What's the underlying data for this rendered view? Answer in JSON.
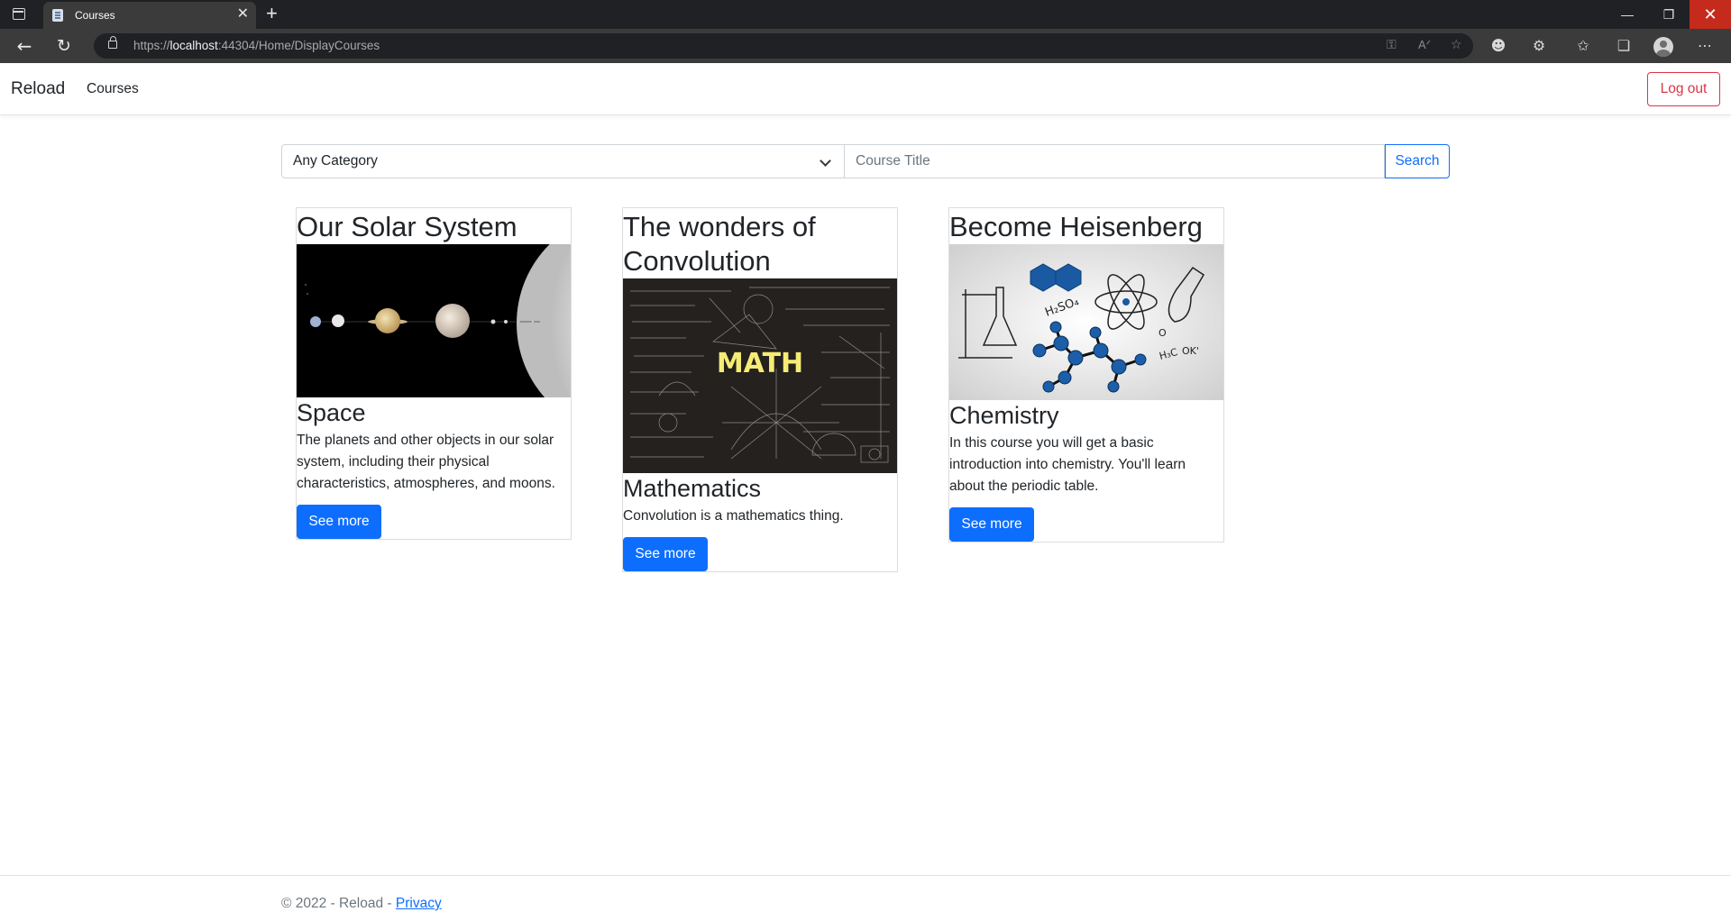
{
  "browser": {
    "tab_title": "Courses",
    "url_prefix": "https://",
    "url_host": "localhost",
    "url_rest": ":44304/Home/DisplayCourses"
  },
  "navbar": {
    "brand": "Reload",
    "courses_link": "Courses",
    "logout_label": "Log out"
  },
  "search": {
    "category_selected": "Any Category",
    "title_placeholder": "Course Title",
    "button_label": "Search"
  },
  "courses": [
    {
      "title": "Our Solar System",
      "category": "Space",
      "description": "The planets and other objects in our solar system, including their physical characteristics, atmospheres, and moons.",
      "button": "See more",
      "image_icon": "solar-system-image"
    },
    {
      "title": "The wonders of Convolution",
      "category": "Mathematics",
      "description": "Convolution is a mathematics thing.",
      "button": "See more",
      "image_icon": "math-chalkboard-image",
      "image_text": "MATH"
    },
    {
      "title": "Become Heisenberg",
      "category": "Chemistry",
      "description": "In this course you will get a basic introduction into chemistry. You'll learn about the periodic table.",
      "button": "See more",
      "image_icon": "chemistry-image",
      "image_text_1": "H₂SO₄",
      "image_text_2": "H₃C",
      "image_text_3": "O",
      "image_text_4": "OK'"
    }
  ],
  "footer": {
    "copyright": "© 2022 - Reload - ",
    "privacy_link": "Privacy"
  },
  "colors": {
    "primary": "#0d6efd",
    "danger": "#dc3545",
    "chrome_dark": "#202124",
    "close_red": "#c42b1c"
  }
}
